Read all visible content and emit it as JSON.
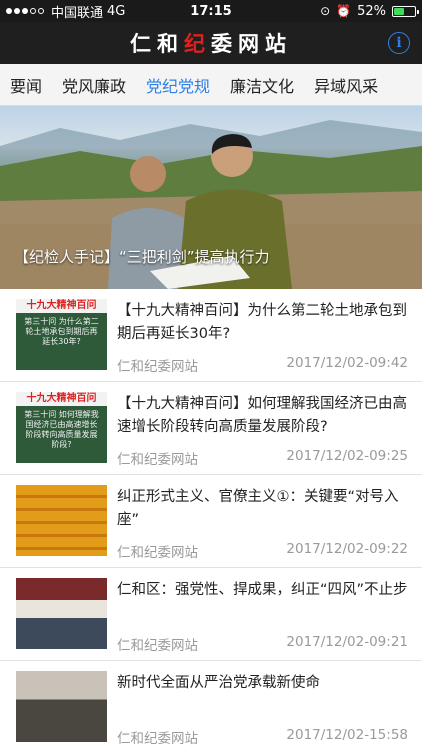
{
  "status_bar": {
    "carrier": "中国联通",
    "network": "4G",
    "time": "17:15",
    "battery_percent": "52%",
    "battery_level": 0.52
  },
  "header": {
    "title_part1": "仁和",
    "title_accent": "纪",
    "title_part2": "委网站",
    "info_icon": "info-icon",
    "accent_color": "#e02020"
  },
  "tabs": [
    {
      "label": "要闻"
    },
    {
      "label": "党风廉政"
    },
    {
      "label": "党纪党规",
      "active": true
    },
    {
      "label": "廉洁文化"
    },
    {
      "label": "异域风采"
    }
  ],
  "hero": {
    "caption": "【纪检人手记】“三把利剑”提高执行力"
  },
  "news": [
    {
      "title": "【十九大精神百问】为什么第二轮土地承包到期后再延长30年?",
      "source": "仁和纪委网站",
      "date": "2017/12/02-09:42",
      "thumb_head": "十九大精神百问",
      "thumb_body": "第三十问 为什么第二轮土地承包到期后再延长30年?"
    },
    {
      "title": "【十九大精神百问】如何理解我国经济已由高速增长阶段转向高质量发展阶段?",
      "source": "仁和纪委网站",
      "date": "2017/12/02-09:25",
      "thumb_head": "十九大精神百问",
      "thumb_body": "第三十问 如何理解我国经济已由高速增长阶段转向高质量发展阶段?"
    },
    {
      "title": "纠正形式主义、官僚主义①：关键要“对号入座”",
      "source": "仁和纪委网站",
      "date": "2017/12/02-09:22"
    },
    {
      "title": "仁和区：强党性、捍成果，纠正“四风”不止步",
      "source": "仁和纪委网站",
      "date": "2017/12/02-09:21"
    },
    {
      "title": "新时代全面从严治党承载新使命",
      "source": "仁和纪委网站",
      "date": "2017/12/02-15:58"
    }
  ],
  "colors": {
    "active_tab": "#2f7fe6",
    "meta_text": "#9a9a9a",
    "header_bg": "#1f1f1f"
  }
}
